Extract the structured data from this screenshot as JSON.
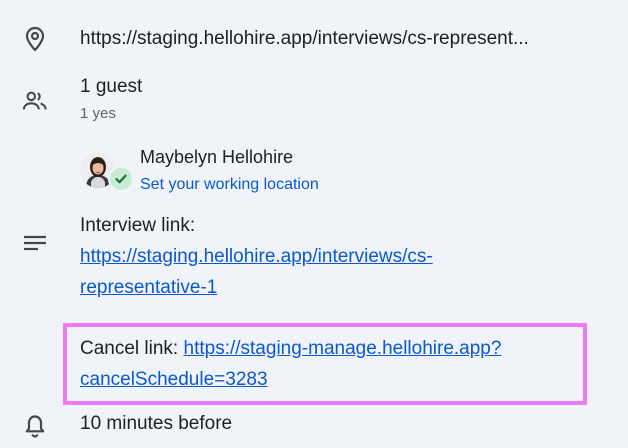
{
  "location": {
    "icon": "location-pin-icon",
    "text": "https://staging.hellohire.app/interviews/cs-represent..."
  },
  "guests": {
    "icon": "people-icon",
    "count_label": "1 guest",
    "rsvp_summary": "1 yes",
    "list": [
      {
        "name": "Maybelyn Hellohire",
        "status_icon": "check-icon",
        "action_label": "Set your working location"
      }
    ]
  },
  "description": {
    "icon": "notes-icon",
    "interview_label": "Interview link:",
    "interview_url_line1": "https://staging.hellohire.app/interviews/cs-",
    "interview_url_line2": "representative-1",
    "cancel_label": "Cancel link: ",
    "cancel_url_line1": "https://staging-manage.hellohire.app?",
    "cancel_url_line2": "cancelSchedule=3283"
  },
  "notification": {
    "icon": "bell-icon",
    "text": "10 minutes before"
  },
  "colors": {
    "background": "#f0f4f9",
    "link": "#0b57d0",
    "highlight": "#f07af1",
    "check_bg": "#c8ebd4",
    "check_fg": "#137333"
  }
}
